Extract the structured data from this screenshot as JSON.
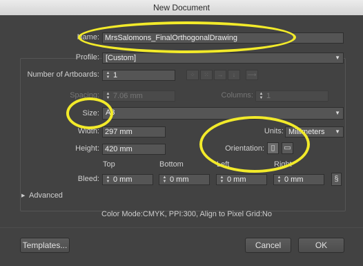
{
  "window": {
    "title": "New Document"
  },
  "form": {
    "name_label": "Name:",
    "name_value": "MrsSalomons_FinalOrthogonalDrawing",
    "profile_label": "Profile:",
    "profile_value": "[Custom]",
    "artboards_label": "Number of Artboards:",
    "artboards_value": "1",
    "spacing_label": "Spacing:",
    "spacing_value": "7.06 mm",
    "columns_label": "Columns:",
    "columns_value": "1",
    "size_label": "Size:",
    "size_value": "A3",
    "width_label": "Width:",
    "width_value": "297 mm",
    "units_label": "Units:",
    "units_value": "Millimeters",
    "height_label": "Height:",
    "height_value": "420 mm",
    "orientation_label": "Orientation:",
    "bleed_label": "Bleed:",
    "bleed_top_header": "Top",
    "bleed_bottom_header": "Bottom",
    "bleed_left_header": "Left",
    "bleed_right_header": "Right",
    "bleed_top": "0 mm",
    "bleed_bottom": "0 mm",
    "bleed_left": "0 mm",
    "bleed_right": "0 mm",
    "advanced_label": "Advanced",
    "info_text": "Color Mode:CMYK, PPI:300, Align to Pixel Grid:No"
  },
  "buttons": {
    "templates": "Templates...",
    "cancel": "Cancel",
    "ok": "OK"
  },
  "icons": {
    "spinner": "up-down-arrows",
    "dropdown": "chevron-down",
    "portrait": "portrait-orientation",
    "landscape": "landscape-orientation",
    "link": "chain-link",
    "disclosure": "triangle-right"
  },
  "colors": {
    "annotation": "#f2ea2a",
    "focus_border": "#d08a3a",
    "panel": "#424242"
  }
}
